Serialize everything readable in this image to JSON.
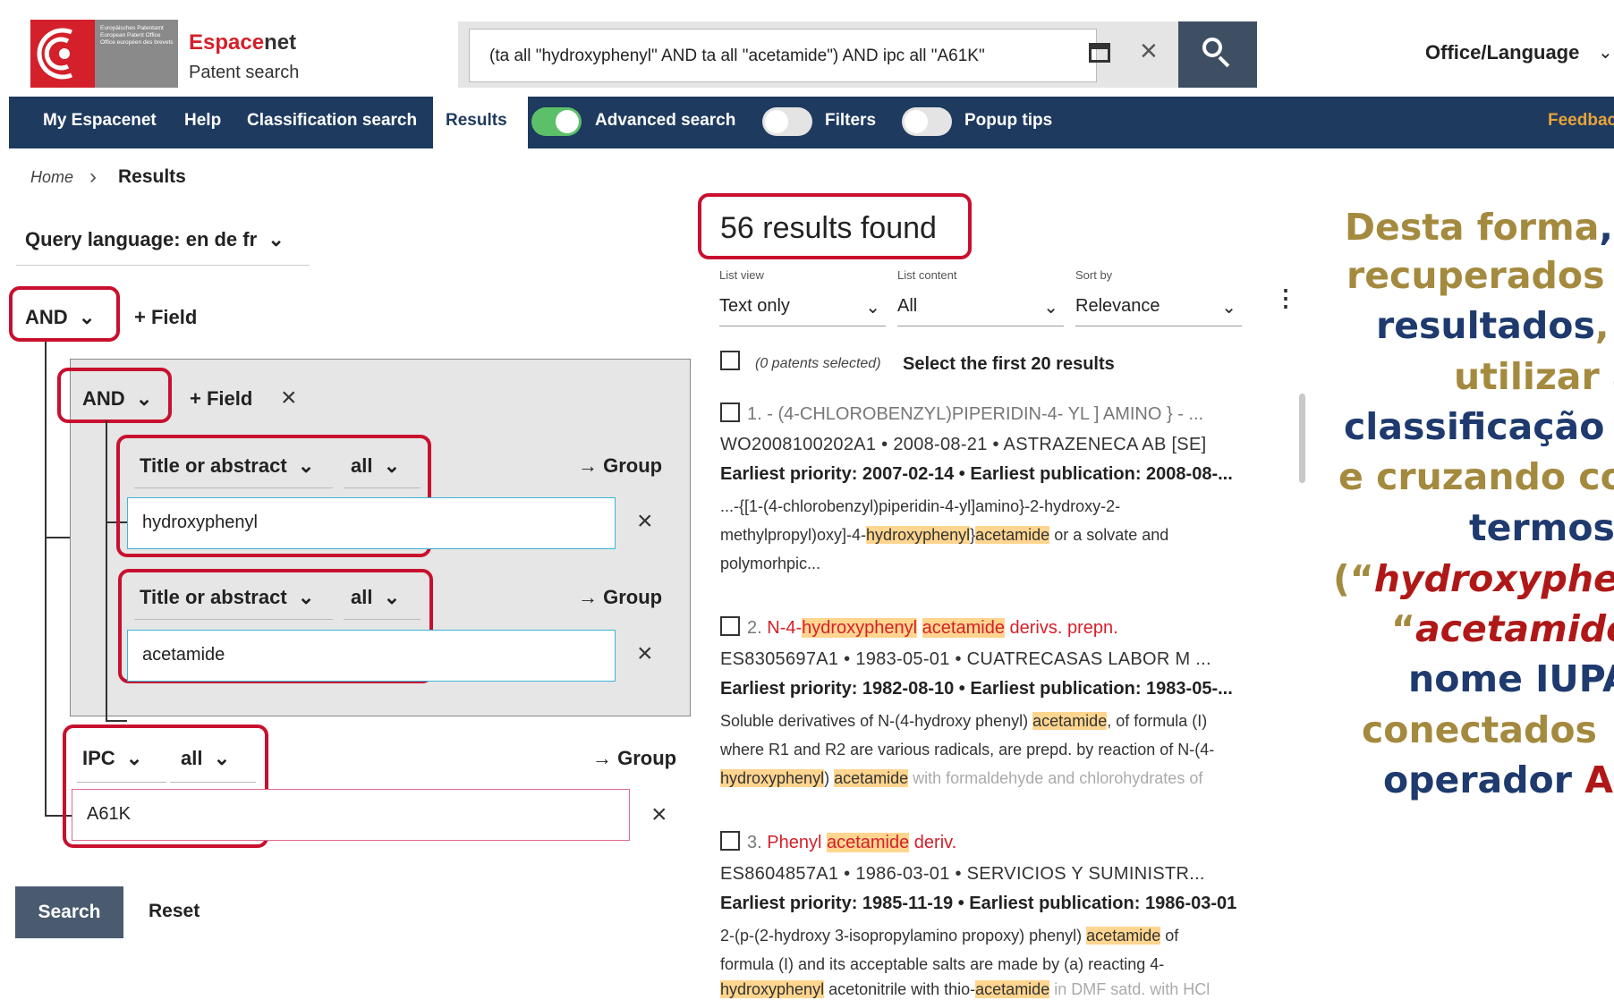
{
  "header": {
    "logo_text": "Europäisches Patentamt European Patent Office Office européen des brevets",
    "brand_red": "Espace",
    "brand_rest": "net",
    "brand_sub": "Patent search",
    "search_query": "(ta all \"hydroxyphenyl\" AND ta all \"acetamide\") AND ipc all \"A61K\"",
    "clear_symbol": "×",
    "office_language": "Office/Language",
    "chevron": "⌄"
  },
  "nav": {
    "my_espacenet": "My Espacenet",
    "help": "Help",
    "classification_search": "Classification search",
    "results": "Results",
    "advanced_search": "Advanced search",
    "filters": "Filters",
    "popup_tips": "Popup tips",
    "feedback": "Feedback",
    "advanced_search_on": true,
    "filters_on": false,
    "popup_tips_on": false
  },
  "breadcrumb": {
    "home": "Home",
    "sep": "›",
    "current": "Results"
  },
  "query_builder": {
    "query_language": "Query language: en de fr",
    "root_operator": "AND",
    "add_field": "+ Field",
    "group_operator": "AND",
    "group_add_field": "+ Field",
    "remove": "×",
    "to_group": "→ Group",
    "rows": [
      {
        "field": "Title or abstract",
        "mode": "all",
        "value": "hydroxyphenyl"
      },
      {
        "field": "Title or abstract",
        "mode": "all",
        "value": "acetamide"
      },
      {
        "field": "IPC",
        "mode": "all",
        "value": "A61K"
      }
    ],
    "search_button": "Search",
    "reset_button": "Reset"
  },
  "results": {
    "count_text": "56 results found",
    "list_view_label": "List view",
    "list_view_value": "Text only",
    "list_content_label": "List content",
    "list_content_value": "All",
    "sort_by_label": "Sort by",
    "sort_by_value": "Relevance",
    "kebab": "⋮",
    "patents_selected": "(0 patents selected)",
    "select_first": "Select the first 20 results",
    "items": [
      {
        "title": "1. - (4-CHLOROBENZYL)PIPERIDIN-4- YL ] AMINO } - ...",
        "meta": "WO2008100202A1 • 2008-08-21 • ASTRAZENECA AB [SE]",
        "priority": "Earliest priority: 2007-02-14 • Earliest publication: 2008-08-...",
        "abs1": "...-{[1-(4-chlorobenzyl)piperidin-4-yl]amino}-2-hydroxy-2-",
        "abs2_a": "methylpropyl)oxy]-4-",
        "abs2_hl1": "hydroxyphenyl",
        "abs2_b": "}",
        "abs2_hl2": "acetamide",
        "abs2_c": " or a solvate and",
        "abs3": "polymorhpic..."
      },
      {
        "num": "2. ",
        "t_a": "N-4-",
        "t_hl1": "hydroxyphenyl",
        "t_sp": " ",
        "t_hl2": "acetamide",
        "t_b": " derivs. prepn.",
        "meta": "ES8305697A1 • 1983-05-01 • CUATRECASAS LABOR M ...",
        "priority": "Earliest priority: 1982-08-10 • Earliest publication: 1983-05-...",
        "abs1_a": "Soluble derivatives of N-(4-hydroxy phenyl) ",
        "abs1_hl": "acetamide",
        "abs1_b": ", of formula (I)",
        "abs2": "where R1 and R2 are various radicals, are prepd. by reaction of N-(4-",
        "abs3_hl1": "hydroxyphenyl",
        "abs3_a": ") ",
        "abs3_hl2": "acetamide",
        "abs3_b": " with formaldehyde and chlorohydrates of"
      },
      {
        "num": "3. ",
        "t_a": "Phenyl ",
        "t_hl": "acetamide",
        "t_b": " deriv.",
        "meta": "ES8604857A1 • 1986-03-01 • SERVICIOS Y SUMINISTR...",
        "priority": "Earliest priority: 1985-11-19 • Earliest publication: 1986-03-01",
        "abs1_a": "2-(p-(2-hydroxy 3-isopropylamino propoxy) phenyl) ",
        "abs1_hl": "acetamide",
        "abs1_b": " of",
        "abs2": "formula (I) and its acceptable salts are made by (a) reacting 4-",
        "abs3_hl1": "hydroxyphenyl",
        "abs3_a": " acetonitrile with thio-",
        "abs3_hl2": "acetamide",
        "abs3_b": " in DMF satd. with HCl"
      }
    ]
  },
  "annotation": {
    "l1_a": "Desta forma",
    "l1_b": ", f",
    "l2": "recuperados",
    "l3_a": "resultados",
    "l3_b": ",",
    "l4": "utilizar a",
    "l5": "classificação",
    "l6": "e cruzando co",
    "l7": "termos",
    "l8_a": "(“",
    "l8_b": "hydroxyphen",
    "l9_a": "“",
    "l9_b": "acetamide",
    "l10": "nome IUPA",
    "l11": "conectados",
    "l12_a": "operador ",
    "l12_b": "A"
  },
  "colors": {
    "brand_red": "#d4202a",
    "nav_bg": "#1e3a5f",
    "toggle_on": "#5cc068",
    "highlight_box": "#c8102e",
    "term_highlight": "#ffd58f",
    "annotation_olive": "#a48a3e",
    "annotation_navy": "#1e3a6e"
  }
}
